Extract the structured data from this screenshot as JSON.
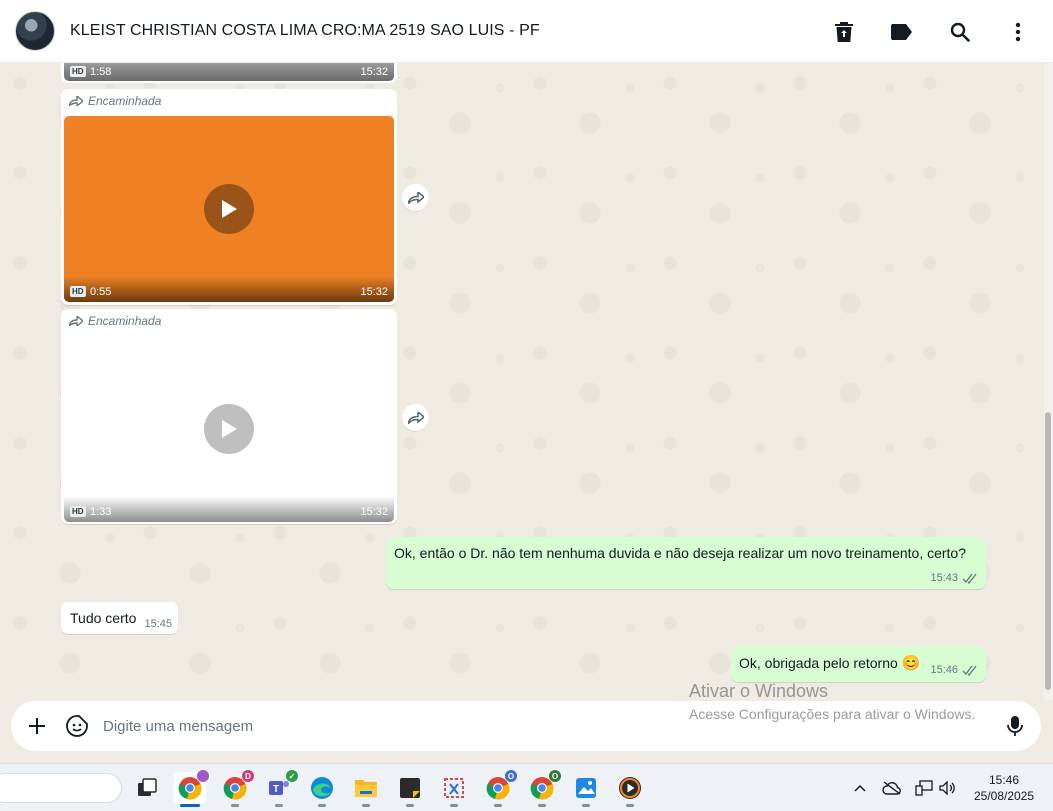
{
  "header": {
    "contact_name": "KLEIST CHRISTIAN COSTA LIMA CRO:MA 2519 SAO LUIS - PF",
    "actions": [
      "delete-icon",
      "label-icon",
      "search-icon",
      "more-vertical-icon"
    ]
  },
  "messages": {
    "partial_video": {
      "hd": "HD",
      "duration": "1:58",
      "time": "15:32"
    },
    "video_1": {
      "forwarded_label": "Encaminhada",
      "hd": "HD",
      "duration": "0:55",
      "time": "15:32",
      "thumbnail_color": "#ef8124"
    },
    "video_2": {
      "forwarded_label": "Encaminhada",
      "hd": "HD",
      "duration": "1:33",
      "time": "15:32"
    },
    "out_1": {
      "text": "Ok, então o Dr. não tem nenhuma duvida e não deseja realizar um novo treinamento, certo?",
      "time": "15:43"
    },
    "in_1": {
      "text": "Tudo certo",
      "time": "15:45"
    },
    "out_2": {
      "text": "Ok, obrigada pelo retorno",
      "emoji": "😊",
      "time": "15:46"
    }
  },
  "composer": {
    "placeholder": "Digite uma mensagem"
  },
  "watermark": {
    "title": "Ativar o Windows",
    "subtitle": "Acesse Configurações para ativar o Windows."
  },
  "taskbar": {
    "badges": {
      "chrome_profile_d": "D",
      "chrome_profile_o": "O",
      "chrome_profile_g": "O"
    },
    "time": "15:46",
    "date": "25/08/2025"
  },
  "colors": {
    "outgoing_bubble": "#d9fdd3",
    "incoming_bubble": "#ffffff",
    "chat_background": "#efeae2",
    "read_ticks": "#667781"
  }
}
